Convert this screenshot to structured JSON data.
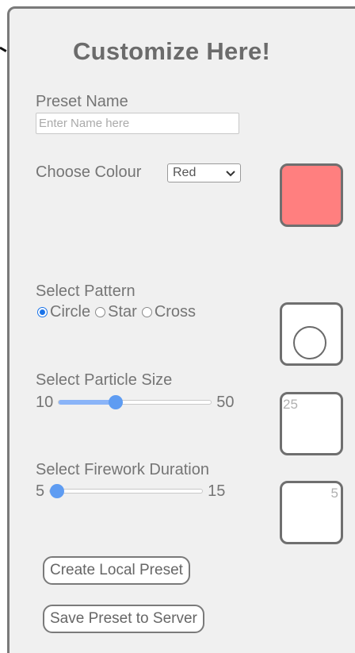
{
  "panel": {
    "title": "Customize Here!"
  },
  "preset_name": {
    "label": "Preset Name",
    "value": "",
    "placeholder": "Enter Name here"
  },
  "colour": {
    "label": "Choose Colour",
    "selected": "Red",
    "preview_color": "#ff7f7f"
  },
  "pattern": {
    "label": "Select Pattern",
    "options": [
      {
        "label": "Circle",
        "checked": true
      },
      {
        "label": "Star",
        "checked": false
      },
      {
        "label": "Cross",
        "checked": false
      }
    ],
    "preview_icon": "circle-icon"
  },
  "particle_size": {
    "label": "Select Particle Size",
    "min": "10",
    "max": "50",
    "value": 25,
    "preview_value": "25"
  },
  "duration": {
    "label": "Select Firework Duration",
    "min": "5",
    "max": "15",
    "value": 5,
    "preview_value": "5"
  },
  "buttons": {
    "create_local": "Create Local Preset",
    "save_server": "Save Preset to Server"
  },
  "colors": {
    "panel_bg": "#f0f0f0",
    "border": "#7a7a7a",
    "accent": "#5e9cf2"
  }
}
